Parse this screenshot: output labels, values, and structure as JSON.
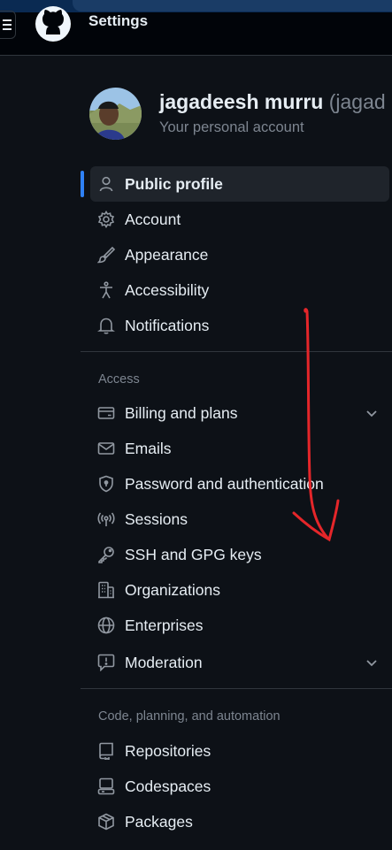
{
  "header": {
    "title": "Settings"
  },
  "profile": {
    "name": "jagadeesh murru",
    "login": "(jagad",
    "subtitle": "Your personal account"
  },
  "nav": {
    "top": [
      {
        "label": "Public profile",
        "icon": "person-icon",
        "active": true
      },
      {
        "label": "Account",
        "icon": "gear-icon"
      },
      {
        "label": "Appearance",
        "icon": "paintbrush-icon"
      },
      {
        "label": "Accessibility",
        "icon": "accessibility-icon"
      },
      {
        "label": "Notifications",
        "icon": "bell-icon"
      }
    ],
    "access_heading": "Access",
    "access": [
      {
        "label": "Billing and plans",
        "icon": "credit-card-icon",
        "expandable": true
      },
      {
        "label": "Emails",
        "icon": "mail-icon"
      },
      {
        "label": "Password and authentication",
        "icon": "shield-lock-icon"
      },
      {
        "label": "Sessions",
        "icon": "broadcast-icon"
      },
      {
        "label": "SSH and GPG keys",
        "icon": "key-icon"
      },
      {
        "label": "Organizations",
        "icon": "organization-icon"
      },
      {
        "label": "Enterprises",
        "icon": "globe-icon"
      },
      {
        "label": "Moderation",
        "icon": "report-icon",
        "expandable": true
      }
    ],
    "code_heading": "Code, planning, and automation",
    "code": [
      {
        "label": "Repositories",
        "icon": "repo-icon"
      },
      {
        "label": "Codespaces",
        "icon": "codespaces-icon"
      },
      {
        "label": "Packages",
        "icon": "package-icon"
      }
    ]
  },
  "colors": {
    "accent": "#2f81f7",
    "annotation": "#e5262a",
    "background": "#0d1117"
  }
}
